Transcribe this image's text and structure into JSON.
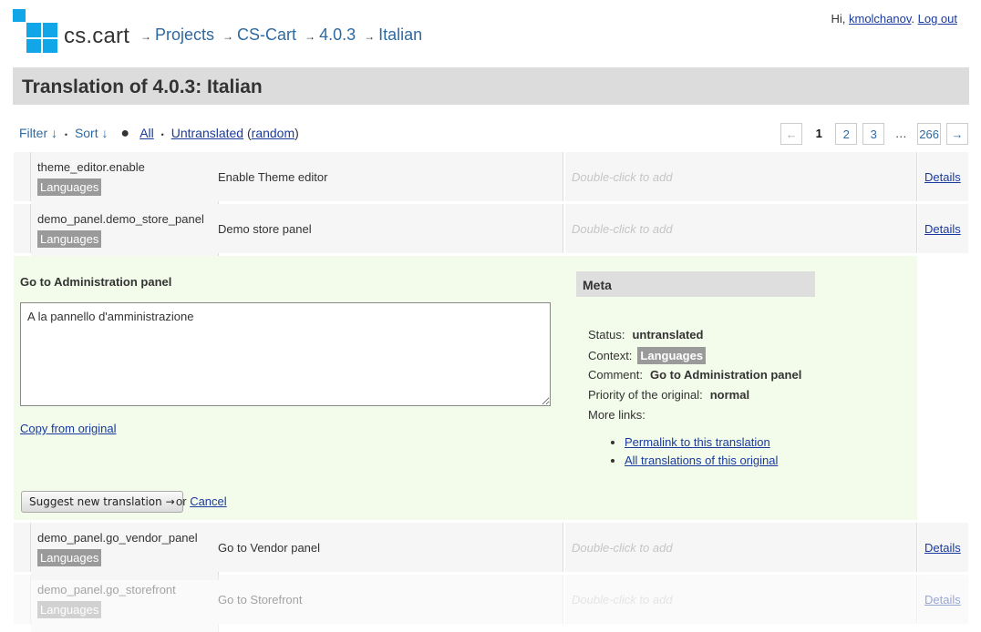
{
  "header": {
    "logo_text": "cs.cart",
    "breadcrumbs": [
      "Projects",
      "CS-Cart",
      "4.0.3",
      "Italian"
    ],
    "user": {
      "greeting": "Hi,",
      "username": "kmolchanov",
      "logout": "Log out"
    }
  },
  "page_title": "Translation of 4.0.3: Italian",
  "filters": {
    "filter_label": "Filter ↓",
    "sort_label": "Sort ↓",
    "all_label": "All",
    "untranslated_label": "Untranslated",
    "random_label": "random"
  },
  "pager": {
    "prev": "←",
    "pages": [
      "1",
      "2",
      "3"
    ],
    "ellipsis": "…",
    "last": "266",
    "next": "→",
    "current": "1"
  },
  "rows_top": [
    {
      "key": "theme_editor.enable",
      "context": "Languages",
      "original": "Enable Theme editor",
      "translation_placeholder": "Double-click to add",
      "details": "Details"
    },
    {
      "key": "demo_panel.demo_store_panel",
      "context": "Languages",
      "original": "Demo store panel",
      "translation_placeholder": "Double-click to add",
      "details": "Details"
    }
  ],
  "editor": {
    "original": "Go to Administration panel",
    "translation_value": "A la pannello d'amministrazione",
    "copy_link": "Copy from original",
    "suggest_button": "Suggest new translation →",
    "or_text": "or",
    "cancel_link": "Cancel",
    "meta": {
      "title": "Meta",
      "status_label": "Status:",
      "status_value": "untranslated",
      "context_label": "Context:",
      "context_value": "Languages",
      "comment_label": "Comment:",
      "comment_value": "Go to Administration panel",
      "priority_label": "Priority of the original:",
      "priority_value": "normal",
      "more_links_label": "More links:",
      "links": [
        "Permalink to this translation",
        "All translations of this original"
      ]
    }
  },
  "rows_bottom": [
    {
      "key": "demo_panel.go_vendor_panel",
      "context": "Languages",
      "original": "Go to Vendor panel",
      "translation_placeholder": "Double-click to add",
      "details": "Details"
    },
    {
      "key": "demo_panel.go_storefront",
      "context": "Languages",
      "original": "Go to Storefront",
      "translation_placeholder": "Double-click to add",
      "details": "Details"
    }
  ],
  "colors": {
    "logo_blue": "#11a6e8",
    "editor_bg": "#f3fbea",
    "title_bar": "#dcdcdc"
  }
}
